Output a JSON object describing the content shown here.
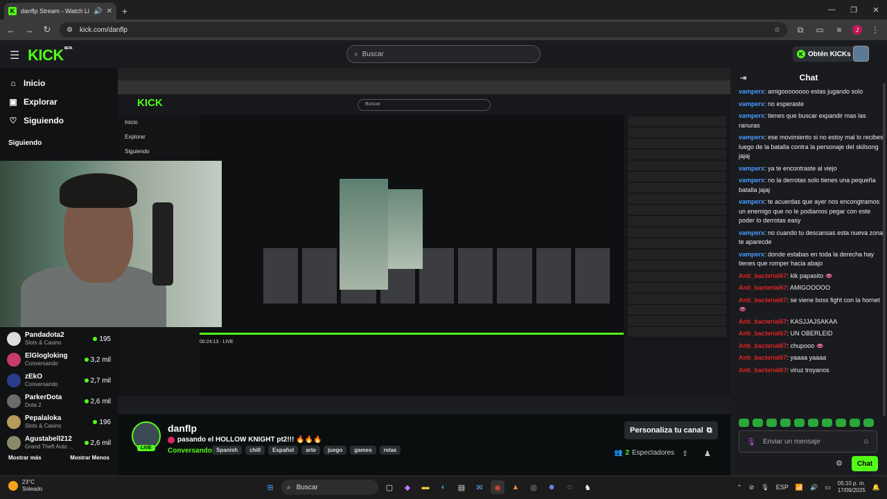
{
  "browser": {
    "tab_title": "danflp Stream - Watch Live",
    "new_tab": "+",
    "url": "kick.com/danflp",
    "profile_initial": "J"
  },
  "header": {
    "logo": "KICK",
    "logo_tag": "BETA",
    "search_placeholder": "Buscar",
    "kicks_button": "Obtén KICKs"
  },
  "sidebar": {
    "nav": [
      {
        "label": "Inicio",
        "icon": "home-icon"
      },
      {
        "label": "Explorar",
        "icon": "explore-icon"
      },
      {
        "label": "Siguiendo",
        "icon": "heart-icon"
      }
    ],
    "following_title": "Siguiendo",
    "streamers": [
      {
        "name": "Pandadota2",
        "category": "Slots & Casino",
        "viewers": "195"
      },
      {
        "name": "ElGlogloking",
        "category": "Conversando",
        "viewers": "3,2 mil"
      },
      {
        "name": "zEkO",
        "category": "Conversando",
        "viewers": "2,7 mil"
      },
      {
        "name": "ParkerDota",
        "category": "Dota 2",
        "viewers": "2,6 mil"
      },
      {
        "name": "Pepalaloka",
        "category": "Slots & Casino",
        "viewers": "196"
      },
      {
        "name": "Agustabell212",
        "category": "Grand Theft Auto ...",
        "viewers": "2,6 mil"
      }
    ],
    "show_more": "Mostrar más",
    "show_less": "Mostrar Menos"
  },
  "player": {
    "inner_logo": "KICK",
    "inner_search": "Buscar",
    "inner_nav": [
      "Inicio",
      "Explorar",
      "Siguiendo"
    ],
    "inner_time": "00:24:13",
    "inner_live": "LIVE"
  },
  "stream": {
    "username": "danflp",
    "title": "pasando el HOLLOW KNIGHT pt2!!! 🔥🔥🔥",
    "live_badge": "LIVE",
    "category": "Conversando",
    "tags": [
      "Spanish",
      "chill",
      "Español",
      "arte",
      "juego",
      "games",
      "relax"
    ],
    "customize": "Personaliza tu canal",
    "viewers_count": "2",
    "viewers_label": "Espectadores"
  },
  "chat": {
    "title": "Chat",
    "messages": [
      {
        "user": "vamperx",
        "text": "amigoooooooo estas jugando solo",
        "color": "#4a9cff"
      },
      {
        "user": "vamperx",
        "text": "no esperaste",
        "color": "#4a9cff"
      },
      {
        "user": "vamperx",
        "text": "tienes que buscar expandir mas las ranuras",
        "color": "#4a9cff"
      },
      {
        "user": "vamperx",
        "text": "ese movimiento si no estoy mal lo recibes luego de la batalla contra la personaje del skilsong jajaj",
        "color": "#4a9cff"
      },
      {
        "user": "vamperx",
        "text": "ya te encontraste al viejo",
        "color": "#4a9cff"
      },
      {
        "user": "vamperx",
        "text": "no la derrotas solo tienes una pequeña batalla jajaj",
        "color": "#4a9cff"
      },
      {
        "user": "vamperx",
        "text": "te acuerdas que ayer nos encongtramos un enemigo que no le podiamos pegar con este poder lo derrotas easy",
        "color": "#4a9cff"
      },
      {
        "user": "vamperx",
        "text": "no cuando tu descansas esta nueva zona te aparecde",
        "color": "#4a9cff"
      },
      {
        "user": "vamperx",
        "text": "donde estabas en toda la derecha hay tienes que romper hacia abajo",
        "color": "#4a9cff"
      },
      {
        "user": "Anti_bacterial67",
        "text": "klk papasito 👄",
        "color": "#e02424"
      },
      {
        "user": "Anti_bacterial67",
        "text": "AMIGOOOOO",
        "color": "#e02424"
      },
      {
        "user": "Anti_bacterial67",
        "text": "se viene boss fight con la hornet 👄",
        "color": "#e02424"
      },
      {
        "user": "Anti_bacterial67",
        "text": "KASJJAJSAKAA",
        "color": "#e02424"
      },
      {
        "user": "Anti_bacterial67",
        "text": "UN OBERLEID",
        "color": "#e02424"
      },
      {
        "user": "Anti_bacterial67",
        "text": "chupooo 👄",
        "color": "#e02424"
      },
      {
        "user": "Anti_bacterial67",
        "text": "yaaaa yaaaa",
        "color": "#e02424"
      },
      {
        "user": "Anti_bacterial67",
        "text": "viruz troyanos",
        "color": "#e02424"
      }
    ],
    "input_placeholder": "Enviar un mensaje",
    "send_button": "Chat"
  },
  "taskbar": {
    "temp": "23°C",
    "weather": "Soleado",
    "search": "Buscar",
    "lang": "ESP",
    "time": "05:10 p. m.",
    "date": "17/09/2025"
  },
  "colors": {
    "accent": "#53fc18",
    "background": "#0b0e0f"
  }
}
